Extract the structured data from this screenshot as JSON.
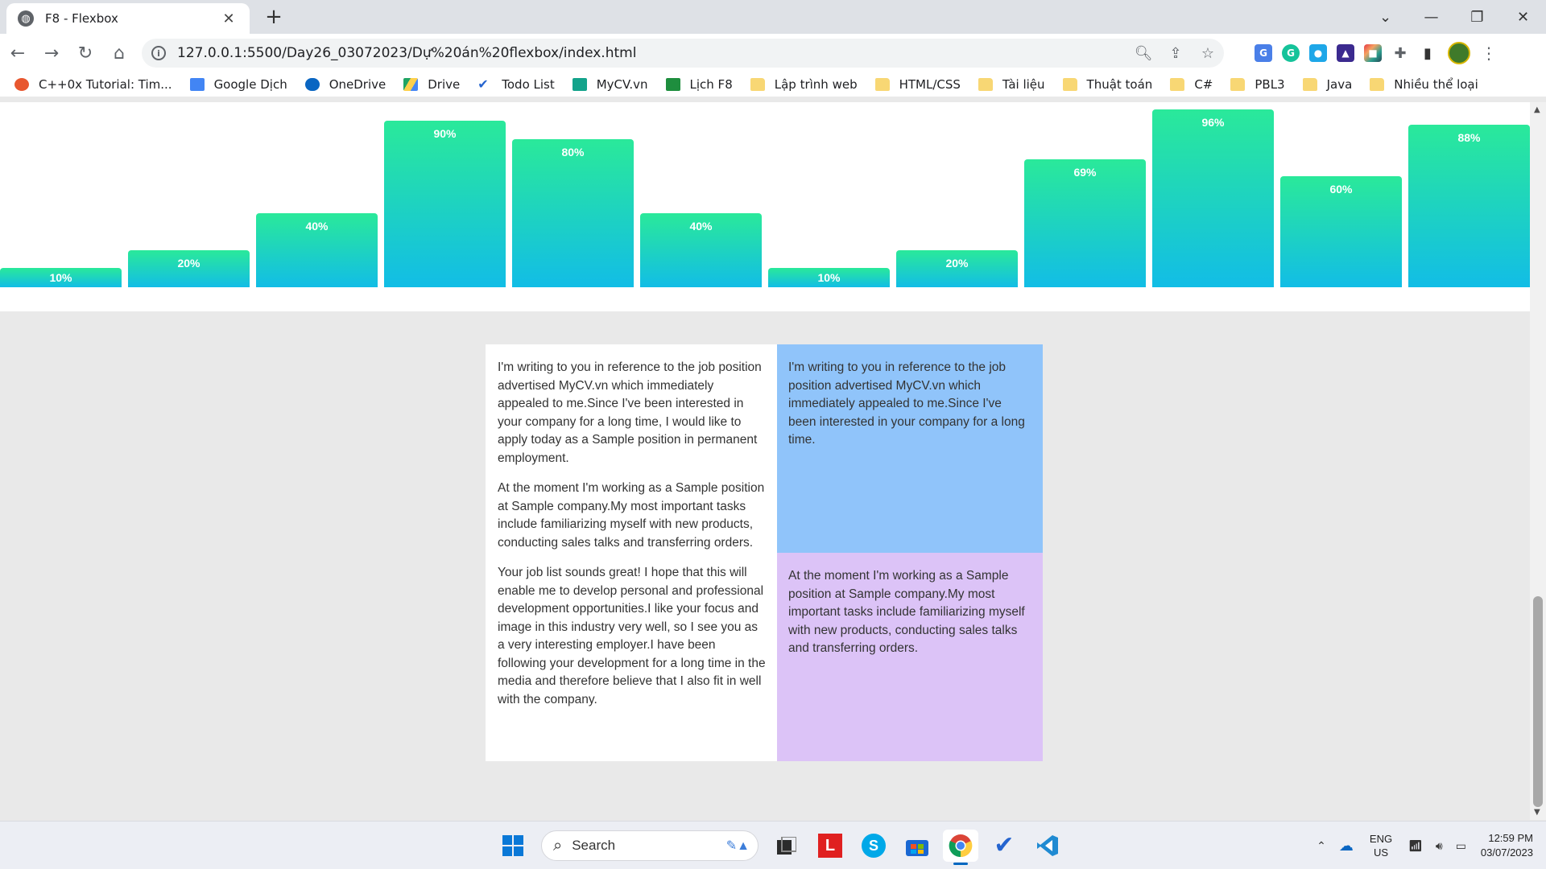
{
  "browser": {
    "tab_title": "F8 - Flexbox",
    "tab_close": "✕",
    "new_tab": "+",
    "url": "127.0.0.1:5500/Day26_03072023/Dự%20án%20flexbox/index.html",
    "window_controls": {
      "minimize": "—",
      "maximize": "❐",
      "close": "✕",
      "tab_search": "⌄"
    }
  },
  "bookmarks": [
    {
      "label": "C++0x Tutorial: Tim...",
      "color": "#e8572f"
    },
    {
      "label": "Google Dịch",
      "color": "#4285f4"
    },
    {
      "label": "OneDrive",
      "color": "#0a66c2"
    },
    {
      "label": "Drive",
      "color": "#1fa463"
    },
    {
      "label": "Todo List",
      "color": "#2564cf"
    },
    {
      "label": "MyCV.vn",
      "color": "#13a38b"
    },
    {
      "label": "Lịch F8",
      "color": "#1e8e3e"
    },
    {
      "label": "Lập trình web",
      "folder": true
    },
    {
      "label": "HTML/CSS",
      "folder": true
    },
    {
      "label": "Tài liệu",
      "folder": true
    },
    {
      "label": "Thuật toán",
      "folder": true
    },
    {
      "label": "C#",
      "folder": true
    },
    {
      "label": "PBL3",
      "folder": true
    },
    {
      "label": "Java",
      "folder": true
    },
    {
      "label": "Nhiều thể loại",
      "folder": true
    }
  ],
  "chart_data": {
    "type": "bar",
    "categories": [
      "",
      "",
      "",
      "",
      "",
      "",
      "",
      "",
      "",
      "",
      "",
      ""
    ],
    "values": [
      10,
      20,
      40,
      90,
      80,
      40,
      10,
      20,
      69,
      96,
      60,
      88
    ],
    "labels": [
      "10%",
      "20%",
      "40%",
      "90%",
      "80%",
      "40%",
      "10%",
      "20%",
      "69%",
      "96%",
      "60%",
      "88%"
    ],
    "ylim": [
      0,
      100
    ],
    "colors": {
      "top": "#2ae99a",
      "bottom": "#12bde6"
    }
  },
  "cards": {
    "main_paragraphs": [
      "I'm writing to you in reference to the job position advertised MyCV.vn which immediately appealed to me.Since I've been interested in your company for a long time, I would like to apply today as a Sample position in permanent employment.",
      "At the moment I'm working as a Sample position at Sample company.My most important tasks include familiarizing myself with new products, conducting sales talks and transferring orders.",
      "Your job list sounds great! I hope that this will enable me to develop personal and professional development opportunities.I like your focus and image in this industry very well, so I see you as a very interesting employer.I have been following your development for a long time in the media and therefore believe that I also fit in well with the company."
    ],
    "side_top": "I'm writing to you in reference to the job position advertised MyCV.vn which immediately appealed to me.Since I've been interested in your company for a long time.",
    "side_bottom": "At the moment I'm working as a Sample position at Sample company.My most important tasks include familiarizing myself with new products, conducting sales talks and transferring orders.",
    "colors": {
      "blue": "#90c4fa",
      "purple": "#dcc3f7"
    }
  },
  "taskbar": {
    "search_label": "Search",
    "lang_top": "ENG",
    "lang_bottom": "US",
    "time": "12:59 PM",
    "date": "03/07/2023"
  }
}
